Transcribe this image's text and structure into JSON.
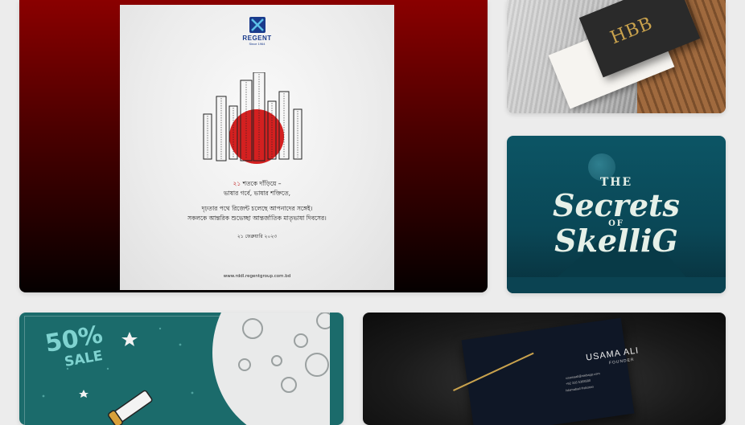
{
  "gallery": {
    "items": [
      {
        "name": "Regent anniversary poster",
        "logo_text": "REGENT",
        "logo_sub": "Since 1964",
        "line1_red": "২১",
        "line1_rest": " শতকে দাঁড়িয়ে –",
        "line2": "ভাষার গর্বে, ভাষার শক্তিতে,",
        "line3": "দৃঢ়তার পথে রিজেন্ট চলেছে আপনাদের সঙ্গেই।",
        "line4": "সকলকে আন্তরিক শুভেচ্ছা আন্তর্জাতিক মাতৃভাষা দিবসের।",
        "date": "২১ ফেব্রুয়ারি ২০২৩",
        "url": "www.rddl.regentgroup.com.bd"
      },
      {
        "name": "HBB business cards",
        "monogram": "HBB"
      },
      {
        "name": "The Secrets of Skellig",
        "the": "THE",
        "secrets": "Secrets",
        "of": "OF",
        "skellig": "SkelliG"
      },
      {
        "name": "50% sale",
        "percent": "50%",
        "sale": "SALE"
      },
      {
        "name": "Usama Ali business card",
        "person": "USAMA ALI",
        "role": "FOUNDER",
        "email": "usamaali@webapp.com",
        "phone": "+92 316 5368580",
        "location": "Islamabad Pakistan"
      }
    ]
  },
  "colors": {
    "poster_red": "#c21b1b",
    "regent_blue": "#1a3b8c",
    "skellig_teal": "#0c5565",
    "gold": "#c9a24d"
  }
}
